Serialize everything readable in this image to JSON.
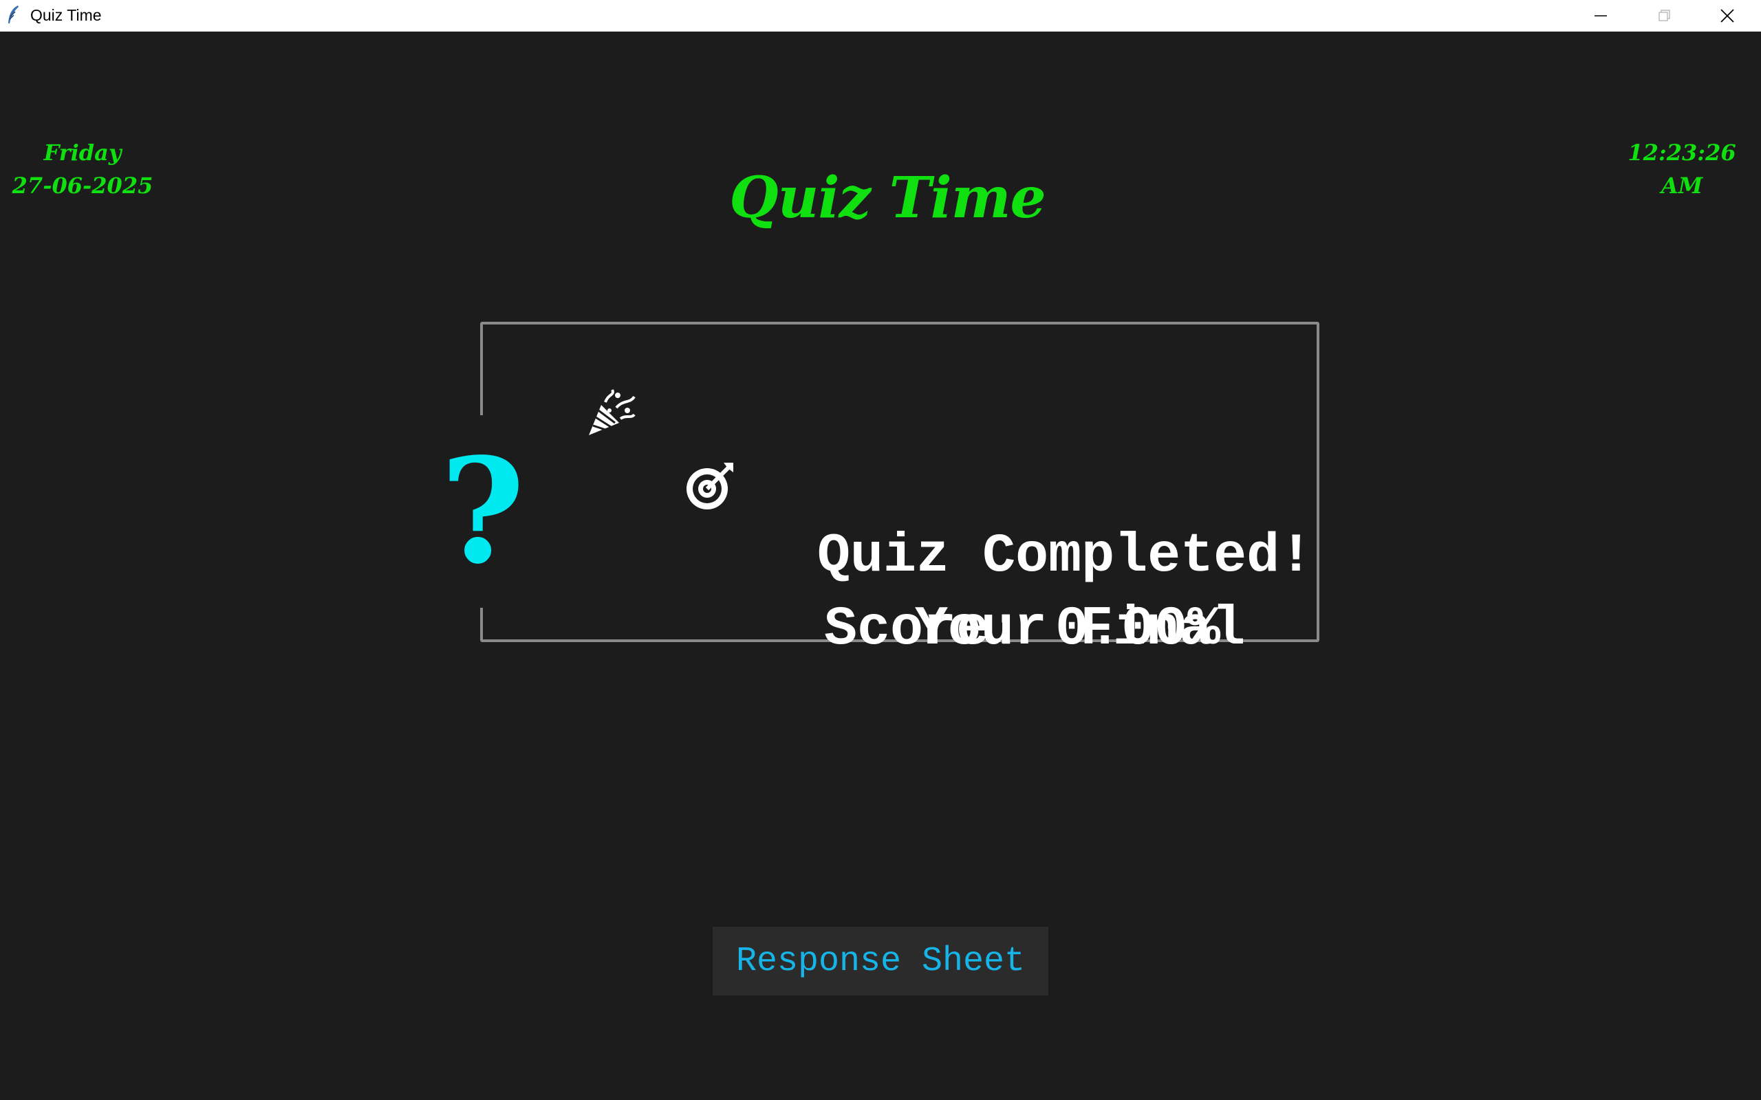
{
  "window": {
    "title": "Quiz Time",
    "icon": "feather-icon",
    "controls": [
      "minimize-icon",
      "maximize-icon",
      "close-icon"
    ]
  },
  "header": {
    "day": "Friday",
    "date": "27-06-2025",
    "title": "Quiz Time",
    "time": "12:23:26",
    "meridiem": "AM"
  },
  "result": {
    "badge_icon": "question-mark-icon",
    "completed_icon": "party-popper-icon",
    "completed_text": "Quiz Completed!",
    "score_icon": "target-icon",
    "score_label_part1": "Your Final",
    "score_label_part2": "Score: 0.00%"
  },
  "actions": {
    "response_sheet_label": "Response Sheet"
  },
  "colors": {
    "background": "#1c1c1c",
    "accent_green": "#10e010",
    "question_mark": "#00e8f0",
    "button_text": "#17b4e8",
    "button_bg": "#2b2b2b",
    "panel_border": "#8a8a8a"
  }
}
